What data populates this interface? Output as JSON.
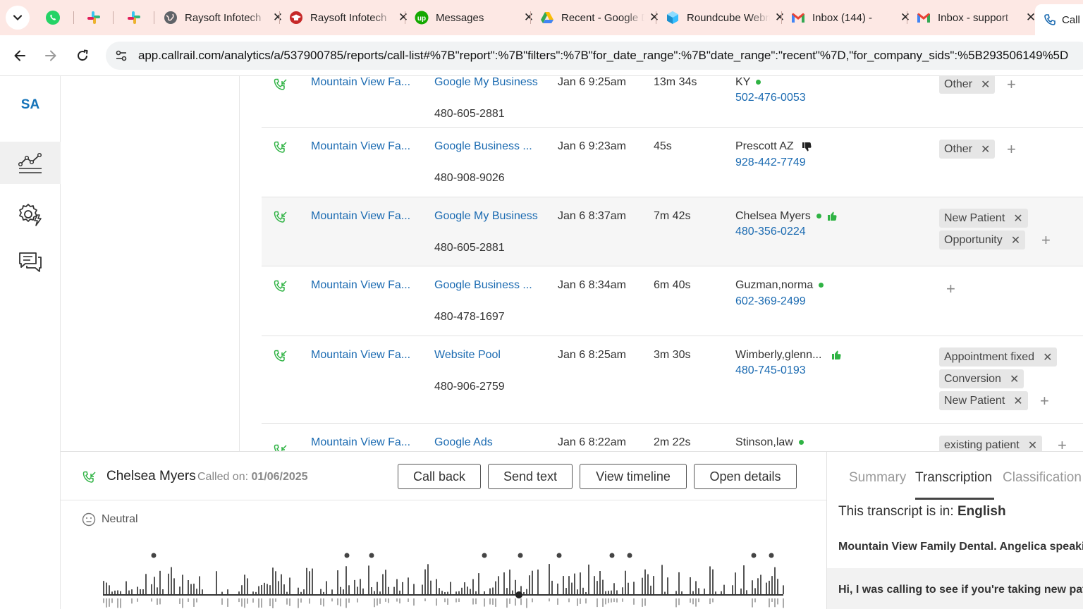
{
  "browser": {
    "tabs": [
      {
        "title": "Raysoft Infotech",
        "icon": "globe-icon"
      },
      {
        "title": "Raysoft Infotech",
        "icon": "graduation-cap-icon"
      },
      {
        "title": "Messages",
        "icon": "upwork-icon"
      },
      {
        "title": "Recent - Google Drive",
        "icon": "google-drive-icon"
      },
      {
        "title": "Roundcube Webmail",
        "icon": "roundcube-icon"
      },
      {
        "title": "Inbox (144) -",
        "icon": "gmail-icon"
      },
      {
        "title": "Inbox - support",
        "icon": "gmail-icon"
      }
    ],
    "active_tab": {
      "title": "Call"
    },
    "url": "app.callrail.com/analytics/a/537900785/reports/call-list#%7B\"report\":%7B\"filters\":%7B\"for_date_range\":%7B\"date_range\":\"recent\"%7D,\"for_company_sids\":%5B293506149%5D"
  },
  "rail": {
    "avatar": "SA",
    "items": [
      "analytics-icon",
      "settings-bolt-icon",
      "conversations-icon"
    ]
  },
  "calls": [
    {
      "company": "Mountain View Fa...",
      "source": "Google My Business",
      "tracking": "480-605-2881",
      "date": "Jan 6 9:25am",
      "duration": "13m 34s",
      "caller": "KY",
      "caller_number": "502-476-0053",
      "dot": true,
      "thumb": "",
      "tags": [
        "Other"
      ]
    },
    {
      "company": "Mountain View Fa...",
      "source": "Google Business ...",
      "tracking": "480-908-9026",
      "date": "Jan 6 9:23am",
      "duration": "45s",
      "caller": "Prescott AZ",
      "caller_number": "928-442-7749",
      "dot": false,
      "thumb": "down",
      "tags": [
        "Other"
      ]
    },
    {
      "company": "Mountain View Fa...",
      "source": "Google My Business",
      "tracking": "480-605-2881",
      "date": "Jan 6 8:37am",
      "duration": "7m 42s",
      "caller": "Chelsea Myers",
      "caller_number": "480-356-0224",
      "dot": true,
      "thumb": "up",
      "tags": [
        "New Patient",
        "Opportunity"
      ]
    },
    {
      "company": "Mountain View Fa...",
      "source": "Google Business ...",
      "tracking": "480-478-1697",
      "date": "Jan 6 8:34am",
      "duration": "6m 40s",
      "caller": "Guzman,norma",
      "caller_number": "602-369-2499",
      "dot": true,
      "thumb": "",
      "tags": []
    },
    {
      "company": "Mountain View Fa...",
      "source": "Website Pool",
      "tracking": "480-906-2759",
      "date": "Jan 6 8:25am",
      "duration": "3m 30s",
      "caller": "Wimberly,glenn...",
      "caller_number": "480-745-0193",
      "dot": false,
      "thumb": "up",
      "tags": [
        "Appointment fixed",
        "Conversion",
        "New Patient"
      ]
    },
    {
      "company": "Mountain View Fa...",
      "source": "Google Ads",
      "tracking": "",
      "date": "Jan 6 8:22am",
      "duration": "2m 22s",
      "caller": "Stinson,law",
      "caller_number": "",
      "dot": true,
      "thumb": "",
      "tags": [
        "existing patient"
      ]
    }
  ],
  "detail": {
    "name": "Chelsea Myers",
    "called_on_label": "Called on:",
    "called_on_date": "01/06/2025",
    "buttons": [
      "Call back",
      "Send text",
      "View timeline",
      "Open details"
    ],
    "sentiment": "Neutral"
  },
  "transcript_pane": {
    "tabs": [
      "Summary",
      "Transcription",
      "Classification"
    ],
    "active_tab": "Transcription",
    "lang_prefix": "This transcript is in:",
    "lang": "English",
    "line1": "Mountain View Family Dental. Angelica speaking",
    "line2": "Hi, I was calling to see if you're taking new patients"
  },
  "colors": {
    "link": "#1a6ab1",
    "success": "#2fb344",
    "tab_strip": "#fde8e4"
  }
}
